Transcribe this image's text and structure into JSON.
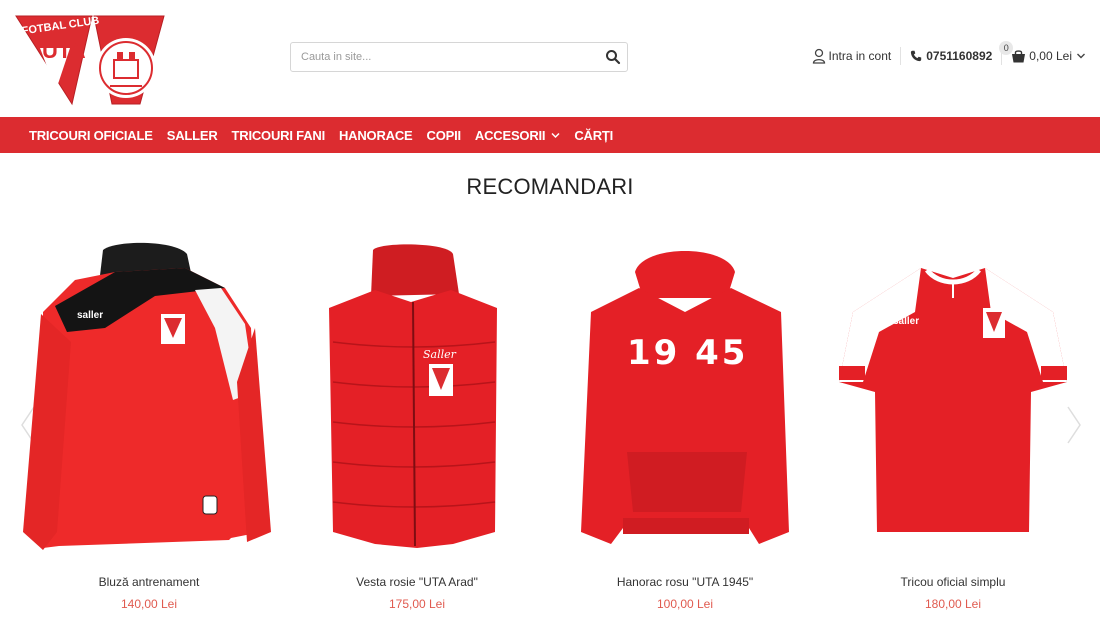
{
  "brand": {
    "logo_text_top": "FOTBAL CLUB",
    "logo_text_main": "UTA",
    "colors": {
      "primary": "#dc2c30",
      "price": "#e05a4f"
    }
  },
  "search": {
    "placeholder": "Cauta in site...",
    "value": ""
  },
  "top_right": {
    "account_label": "Intra in cont",
    "account_icon": "user-icon",
    "phone": "0751160892",
    "phone_icon": "phone-icon",
    "cart_count": "0",
    "cart_total": "0,00 Lei",
    "cart_icon": "shopping-bag-icon"
  },
  "nav": {
    "items": [
      {
        "label": "TRICOURI OFICIALE"
      },
      {
        "label": "SALLER"
      },
      {
        "label": "TRICOURI FANI"
      },
      {
        "label": "HANORACE"
      },
      {
        "label": "COPII"
      },
      {
        "label": "ACCESORII",
        "has_dropdown": true
      },
      {
        "label": "CĂRȚI"
      }
    ]
  },
  "section": {
    "title": "RECOMANDARI"
  },
  "products": [
    {
      "name": "Bluză antrenament",
      "price": "140,00 Lei"
    },
    {
      "name": "Vesta rosie \"UTA Arad\"",
      "price": "175,00 Lei"
    },
    {
      "name": "Hanorac rosu \"UTA 1945\"",
      "price": "100,00 Lei",
      "print": "19 45"
    },
    {
      "name": "Tricou oficial simplu",
      "price": "180,00 Lei"
    }
  ]
}
